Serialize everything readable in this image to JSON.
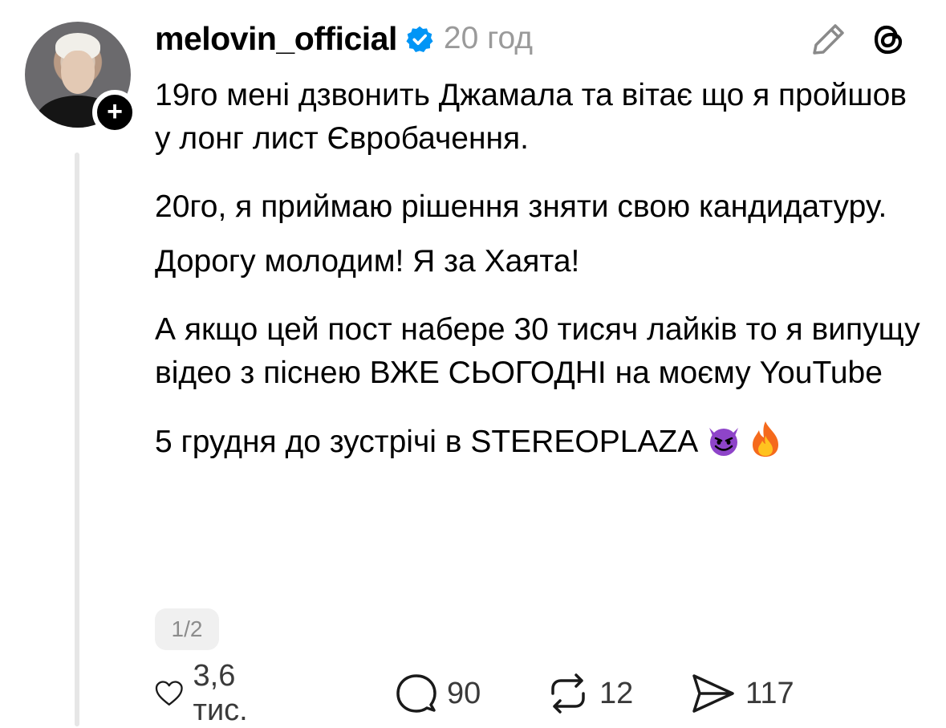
{
  "post": {
    "username": "melovin_official",
    "verified": true,
    "time": "20 год",
    "paragraphs": [
      "19го мені дзвонить Джамала та вітає що я пройшов у лонг лист Євробачення.",
      "20го, я приймаю рішення зняти свою кандидатуру.",
      "Дорогу молодим! Я за Хаята!",
      "А якщо цей пост набере 30 тисяч лайків то я випущу відео з піснею ВЖЕ СЬОГОДНІ на моєму YouTube",
      "5 грудня до зустрічі в STEREOPLAZA"
    ],
    "emojis": [
      "smiling-imp",
      "fire"
    ],
    "pager": "1/2"
  },
  "actions": {
    "likes": "3,6 тис.",
    "comments": "90",
    "reposts": "12",
    "shares": "117"
  },
  "icons": {
    "verified": "verified-badge-icon",
    "edit": "pencil-icon",
    "threads": "threads-logo-icon",
    "like": "heart-icon",
    "comment": "comment-bubble-icon",
    "repost": "repost-icon",
    "share": "share-send-icon"
  },
  "colors": {
    "verified": "#0095f6",
    "muted": "#9a9a9a",
    "text": "#000000"
  }
}
